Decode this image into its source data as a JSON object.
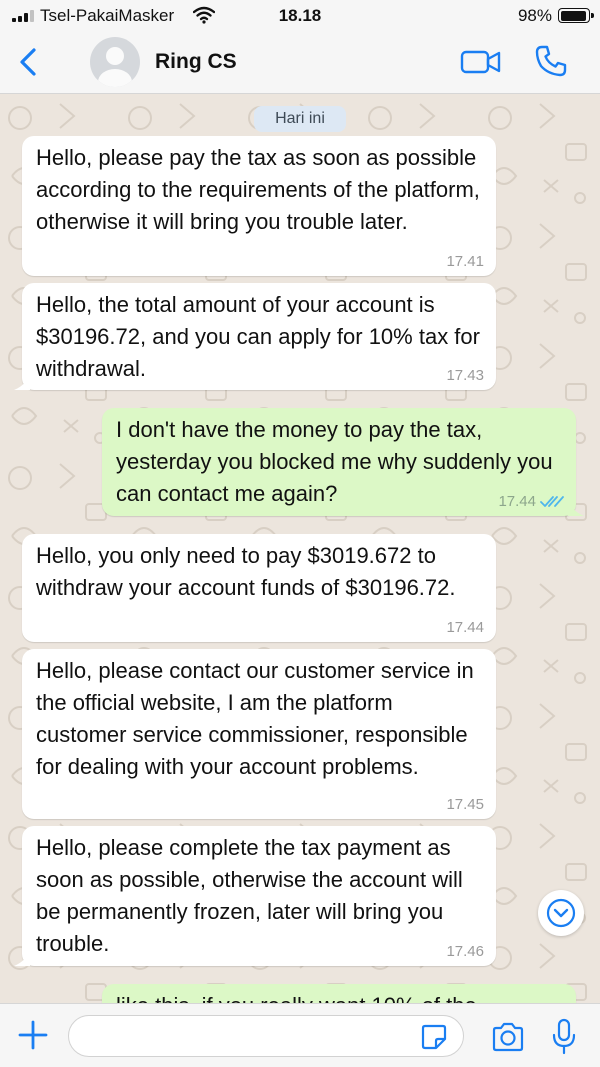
{
  "status_bar": {
    "carrier": "Tsel-PakaiMasker",
    "time": "18.18",
    "battery": "98%"
  },
  "header": {
    "contact_name": "Ring CS"
  },
  "chat": {
    "date_chip": "Hari ini",
    "messages": [
      {
        "direction": "incoming",
        "text": "Hello, please pay the tax as soon as possible according to the requirements of the platform, otherwise it will bring you trouble later.",
        "time": "17.41"
      },
      {
        "direction": "incoming",
        "text": "Hello, the total amount of your account is $30196.72, and you can apply for 10% tax for withdrawal.",
        "time": "17.43"
      },
      {
        "direction": "outgoing",
        "text": "I don't have the money to pay the tax, yesterday you blocked me why suddenly you can contact me again?",
        "time": "17.44",
        "status": "read"
      },
      {
        "direction": "incoming",
        "text": "Hello, you only need to pay $3019.672 to withdraw your account funds of $30196.72.",
        "time": "17.44"
      },
      {
        "direction": "incoming",
        "text": "Hello, please contact our customer service in the official website, I am the platform customer service commissioner, responsible for dealing with your account problems.",
        "time": "17.45"
      },
      {
        "direction": "incoming",
        "text": "Hello, please complete the tax payment as soon as possible, otherwise the account will be permanently frozen, later will bring you trouble.",
        "time": "17.46"
      },
      {
        "direction": "outgoing",
        "text": "like this, if you really want 10% of the",
        "time": ""
      }
    ]
  },
  "input": {
    "value": "",
    "placeholder": ""
  },
  "colors": {
    "accent": "#1a7ef2",
    "outgoing_bubble": "#dcf8c6",
    "incoming_bubble": "#ffffff",
    "chat_background": "#ece5dd",
    "read_ticks": "#4fb6ec"
  },
  "icons": {
    "back": "chevron-left-icon",
    "video": "video-camera-icon",
    "call": "phone-icon",
    "scroll_down": "chevron-down-icon",
    "attach": "plus-icon",
    "sticker": "sticker-icon",
    "camera": "camera-icon",
    "mic": "microphone-icon"
  }
}
